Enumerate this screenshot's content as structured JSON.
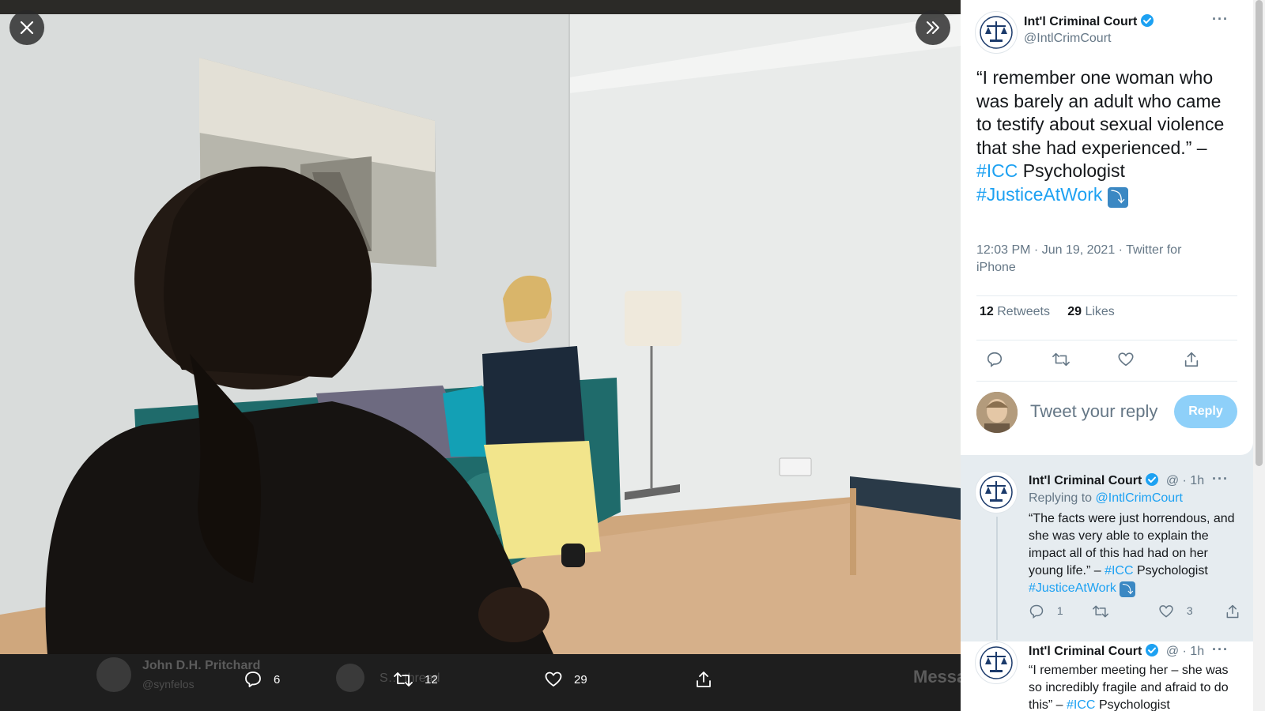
{
  "viewer": {
    "close_icon": "close-icon",
    "expand_icon": "double-chevron-right-icon",
    "action_bar": {
      "reply_count": "6",
      "retweet_count": "12",
      "like_count": "29",
      "share_icon": "share-icon"
    },
    "background_ghost": {
      "name": "John D.H. Pritchard",
      "handle": "@synfelos",
      "thread_label": "S… thread",
      "message_label": "Messa"
    }
  },
  "main_tweet": {
    "author_name": "Int'l Criminal Court",
    "author_handle": "@IntlCrimCourt",
    "text_plain": "“I remember one woman who was barely an adult who came to testify about sexual violence that she had experienced.” –",
    "hashtag1": "#ICC",
    "text_mid": "Psychologist",
    "hashtag2": "#JusticeAtWork",
    "emoji": "⤵",
    "timestamp": "12:03 PM · Jun 19, 2021 · Twitter for iPhone",
    "retweets_count": "12",
    "retweets_label": "Retweets",
    "likes_count": "29",
    "likes_label": "Likes",
    "reply_placeholder": "Tweet your reply",
    "reply_button": "Reply"
  },
  "thread": [
    {
      "author_name": "Int'l Criminal Court",
      "handle_short": "@",
      "time": "· 1h",
      "replying_prefix": "Replying to",
      "replying_to": "@IntlCrimCourt",
      "text_plain": "“The facts were just horrendous, and she was very able to explain the impact all of this had had on her young life.” –",
      "hashtag1": "#ICC",
      "text_mid": "Psychologist",
      "hashtag2": "#JusticeAtWork",
      "emoji": "⤵",
      "reply_count": "1",
      "retweet_count": "",
      "like_count": "3"
    },
    {
      "author_name": "Int'l Criminal Court",
      "handle_short": "@",
      "time": "· 1h",
      "text_plain": "“I remember meeting her – she was so incredibly fragile and afraid to do this” –",
      "hashtag1": "#ICC",
      "text_mid": "Psychologist"
    }
  ],
  "colors": {
    "link": "#1da1f2",
    "text": "#14171a",
    "muted": "#657786",
    "reply_button": "#8ed0f9"
  }
}
